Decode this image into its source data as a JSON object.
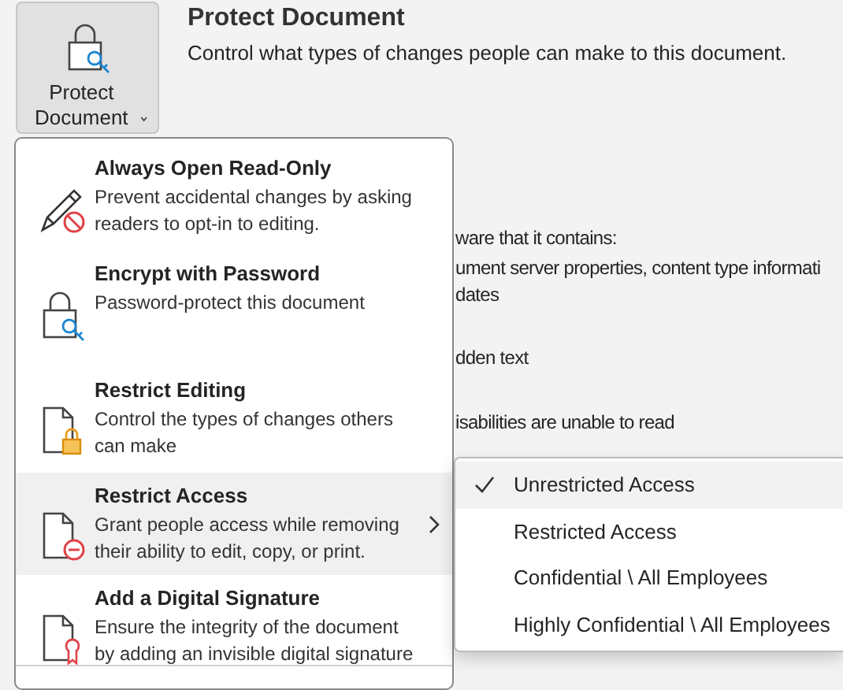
{
  "protect_document": {
    "button_label": "Protect Document",
    "title": "Protect Document",
    "description": "Control what types of changes people can make to this document."
  },
  "background_paragraphs": [
    [
      "ware that it contains:"
    ],
    [
      "ument server properties, content type informati",
      "dates"
    ],
    [
      "dden text"
    ],
    [
      "isabilities are unable to read"
    ]
  ],
  "menu": {
    "items": [
      {
        "kind": "pencil-no",
        "title": "Always Open Read-Only",
        "description": "Prevent accidental changes by asking readers to opt-in to editing.",
        "expanded": false
      },
      {
        "kind": "lock-key",
        "title": "Encrypt with Password",
        "description": "Password-protect this document",
        "expanded": false
      },
      {
        "kind": "doc-lock",
        "title": "Restrict Editing",
        "description": "Control the types of changes others can make",
        "expanded": false
      },
      {
        "kind": "doc-minus",
        "title": "Restrict Access",
        "description": "Grant people access while removing their ability to edit, copy, or print.",
        "expanded": true,
        "submenu": [
          {
            "label": "Unrestricted Access",
            "checked": true,
            "selected": true
          },
          {
            "label": "Restricted Access",
            "checked": false,
            "selected": false
          },
          {
            "label": "Confidential \\ All Employees",
            "checked": false,
            "selected": false
          },
          {
            "label": "Highly Confidential \\ All Employees",
            "checked": false,
            "selected": false
          }
        ]
      },
      {
        "kind": "doc-ribbon",
        "title": "Add a Digital Signature",
        "description": "Ensure the integrity of the document by adding an invisible digital signature",
        "expanded": false
      }
    ]
  }
}
